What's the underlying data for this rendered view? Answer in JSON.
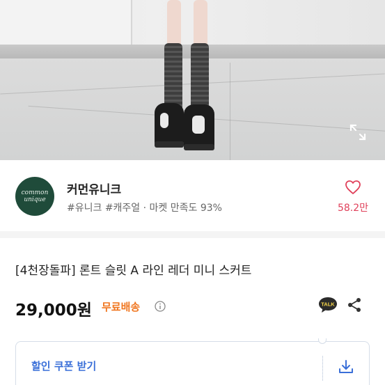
{
  "hero": {
    "expand_icon": "expand-icon"
  },
  "seller": {
    "avatar_line1": "common",
    "avatar_line2": "unique",
    "name": "커먼유니크",
    "tags": "#유니크 #캐주얼 · 마켓 만족도 93%",
    "like_icon": "heart-icon",
    "like_count": "58.2만"
  },
  "product": {
    "title": "[4천장돌파] 론트 슬릿 A 라인 레더 미니 스커트",
    "price": "29,000원",
    "shipping": "무료배송",
    "info_icon": "info-icon",
    "talk_label": "TALK",
    "share_icon": "share-icon"
  },
  "coupon": {
    "label": "할인 쿠폰 받기",
    "download_icon": "download-icon"
  },
  "colors": {
    "accent_blue": "#3a6fd8",
    "shipping_orange": "#f0761f",
    "like_red": "#e0405a",
    "avatar_green": "#1f4b3a"
  }
}
